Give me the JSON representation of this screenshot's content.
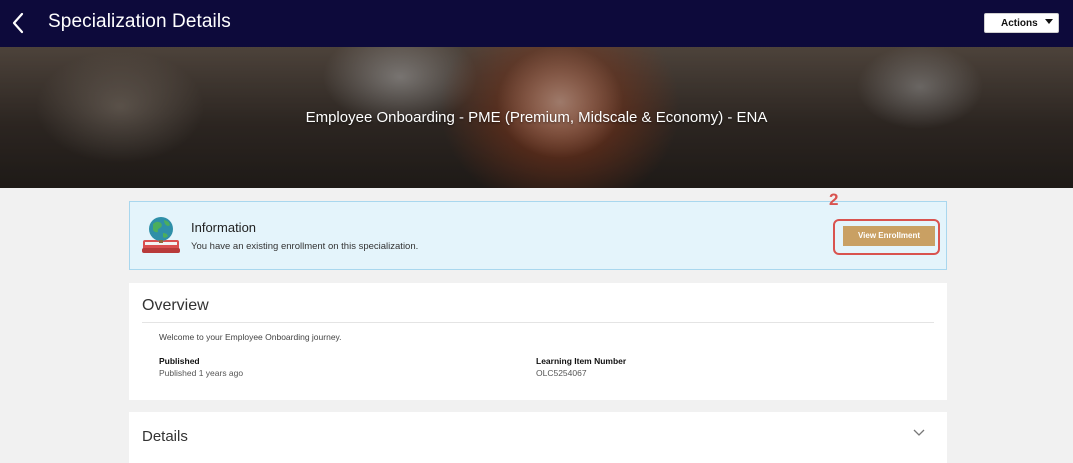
{
  "header": {
    "title": "Specialization Details",
    "actions_label": "Actions"
  },
  "hero": {
    "title": "Employee Onboarding - PME (Premium, Midscale & Economy) - ENA"
  },
  "info_banner": {
    "heading": "Information",
    "message": "You have an existing enrollment on this specialization.",
    "button_label": "View Enrollment",
    "callout_number": "2"
  },
  "overview": {
    "title": "Overview",
    "description": "Welcome to your Employee Onboarding journey.",
    "fields": [
      {
        "label": "Published",
        "value": "Published 1 years ago"
      },
      {
        "label": "Learning Item Number",
        "value": "OLC5254067"
      }
    ]
  },
  "details": {
    "title": "Details"
  },
  "colors": {
    "topbar": "#0d0a3b",
    "accent_button": "#c9a063",
    "callout": "#d9534f",
    "banner_bg": "#e4f4fb"
  }
}
